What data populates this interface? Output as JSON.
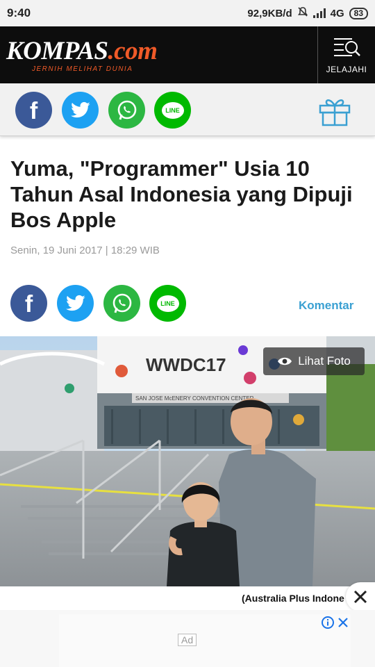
{
  "status": {
    "time": "9:40",
    "speed": "92,9KB/d",
    "network": "4G",
    "battery": "83"
  },
  "header": {
    "logo_main": "KOMPAS",
    "logo_suffix": ".com",
    "tagline": "JERNIH MELIHAT DUNIA",
    "explore_label": "JELAJAHI"
  },
  "share": {
    "facebook": "f",
    "line": "LINE",
    "icons": [
      "facebook-icon",
      "twitter-icon",
      "whatsapp-icon",
      "line-icon",
      "gift-icon"
    ]
  },
  "article": {
    "title": "Yuma, \"Programmer\" Usia 10 Tahun Asal Indonesia yang Dipuji Bos Apple",
    "date": "Senin, 19 Juni 2017 | 18:29 WIB",
    "comment_label": "Komentar"
  },
  "photo": {
    "view_label": "Lihat Foto",
    "banner_text": "WWDC17",
    "building_text": "SAN JOSE McENERY CONVENTION CENTER",
    "caption": "(Australia Plus Indone"
  },
  "ad": {
    "label": "Ad"
  },
  "colors": {
    "brand_orange": "#f05a28",
    "link_blue": "#3aa0d2",
    "facebook": "#3b5998",
    "twitter": "#1da1f2",
    "whatsapp": "#2cb742",
    "line": "#00b900"
  }
}
